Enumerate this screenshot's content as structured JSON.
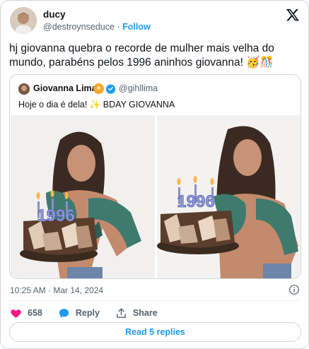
{
  "author": {
    "name": "ducy",
    "handle": "@destroynseduce",
    "separator": "·",
    "follow_label": "Follow"
  },
  "tweet": {
    "text": "hj giovanna quebra o recorde de mulher mais velha do mundo, parabéns pelos 1996 aninhos giovanna! 🥳🎊"
  },
  "quote": {
    "name": "Giovanna Lima",
    "handle": "@gihllima",
    "text": "Hoje o dia é dela! ✨ BDAY GIOVANNA",
    "cake_number": "1996"
  },
  "meta": {
    "timestamp": "10:25 AM · Mar 14, 2024"
  },
  "actions": {
    "like_count": "658",
    "reply_label": "Reply",
    "share_label": "Share"
  },
  "read_replies_label": "Read 5 replies",
  "colors": {
    "accent": "#1d9bf0",
    "like": "#f91880",
    "muted": "#536471",
    "border": "#cfd9de"
  },
  "icons": [
    "x-logo-icon",
    "sun-emoji-icon",
    "verified-badge-icon",
    "info-icon",
    "heart-icon",
    "reply-bubble-icon",
    "share-icon"
  ]
}
